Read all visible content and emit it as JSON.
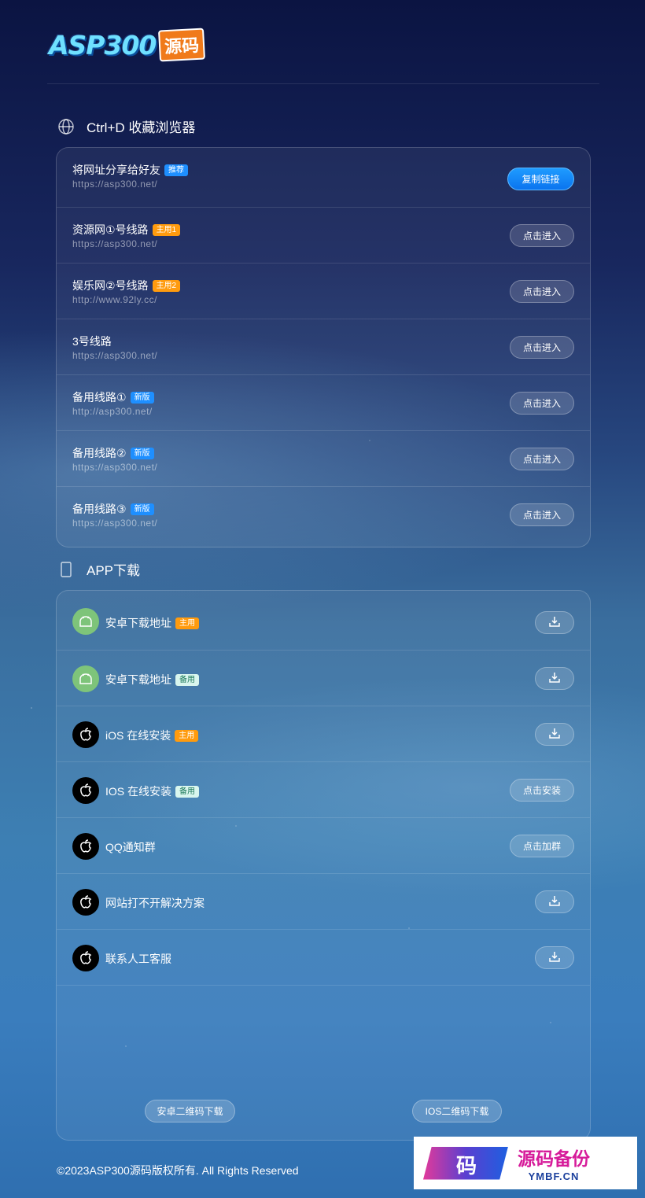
{
  "logo": {
    "main": "ASP300",
    "tag": "源码"
  },
  "section1": {
    "icon": "globe-icon",
    "title": "Ctrl+D 收藏浏览器"
  },
  "links": [
    {
      "title": "将网址分享给好友",
      "badge": "推荐",
      "badge_color": "#1e8fff",
      "url": "https://asp300.net/",
      "button": "复制链接"
    },
    {
      "title": "资源网①号线路",
      "badge": "主用1",
      "badge_color": "#ff9b0e",
      "url": "https://asp300.net/",
      "button": "点击进入"
    },
    {
      "title": "娱乐网②号线路",
      "badge": "主用2",
      "badge_color": "#ff9b0e",
      "url": "http://www.92ly.cc/",
      "button": "点击进入"
    },
    {
      "title": "3号线路",
      "badge": "",
      "url": "https://asp300.net/",
      "button": "点击进入"
    },
    {
      "title": "备用线路①",
      "badge": "新版",
      "badge_color": "#1e8fff",
      "url": "http://asp300.net/",
      "button": "点击进入"
    },
    {
      "title": "备用线路②",
      "badge": "新版",
      "badge_color": "#1e8fff",
      "url": "https://asp300.net/",
      "button": "点击进入"
    },
    {
      "title": "备用线路③",
      "badge": "新版",
      "badge_color": "#1e8fff",
      "url": "https://asp300.net/",
      "button": "点击进入"
    }
  ],
  "section2": {
    "icon": "phone-icon",
    "title": "APP下载"
  },
  "apps": [
    {
      "icon": "android-icon",
      "title": "安卓下载地址",
      "badge": "主用",
      "button_icon": "download-icon"
    },
    {
      "icon": "android-icon",
      "title": "安卓下载地址",
      "badge": "备用",
      "button_icon": "download-icon"
    },
    {
      "icon": "apple-icon",
      "title": "iOS 在线安装",
      "badge": "主用",
      "button_icon": "download-icon"
    },
    {
      "icon": "apple-icon",
      "title": "IOS 在线安装",
      "badge": "备用",
      "button": "点击安装"
    },
    {
      "icon": "apple-icon",
      "title": "QQ通知群",
      "badge": "",
      "button": "点击加群"
    },
    {
      "icon": "apple-icon",
      "title": "网站打不开解决方案",
      "badge": "",
      "button_icon": "download-icon"
    },
    {
      "icon": "apple-icon",
      "title": "联系人工客服",
      "badge": "",
      "button_icon": "download-icon"
    }
  ],
  "qr_buttons": {
    "android": "安卓二维码下载",
    "ios": "IOS二维码下载"
  },
  "footer": "©2023ASP300源码版权所有. All Rights Reserved",
  "watermark": {
    "mark": "码",
    "cn": "源码备份",
    "en": "YMBF.CN"
  }
}
